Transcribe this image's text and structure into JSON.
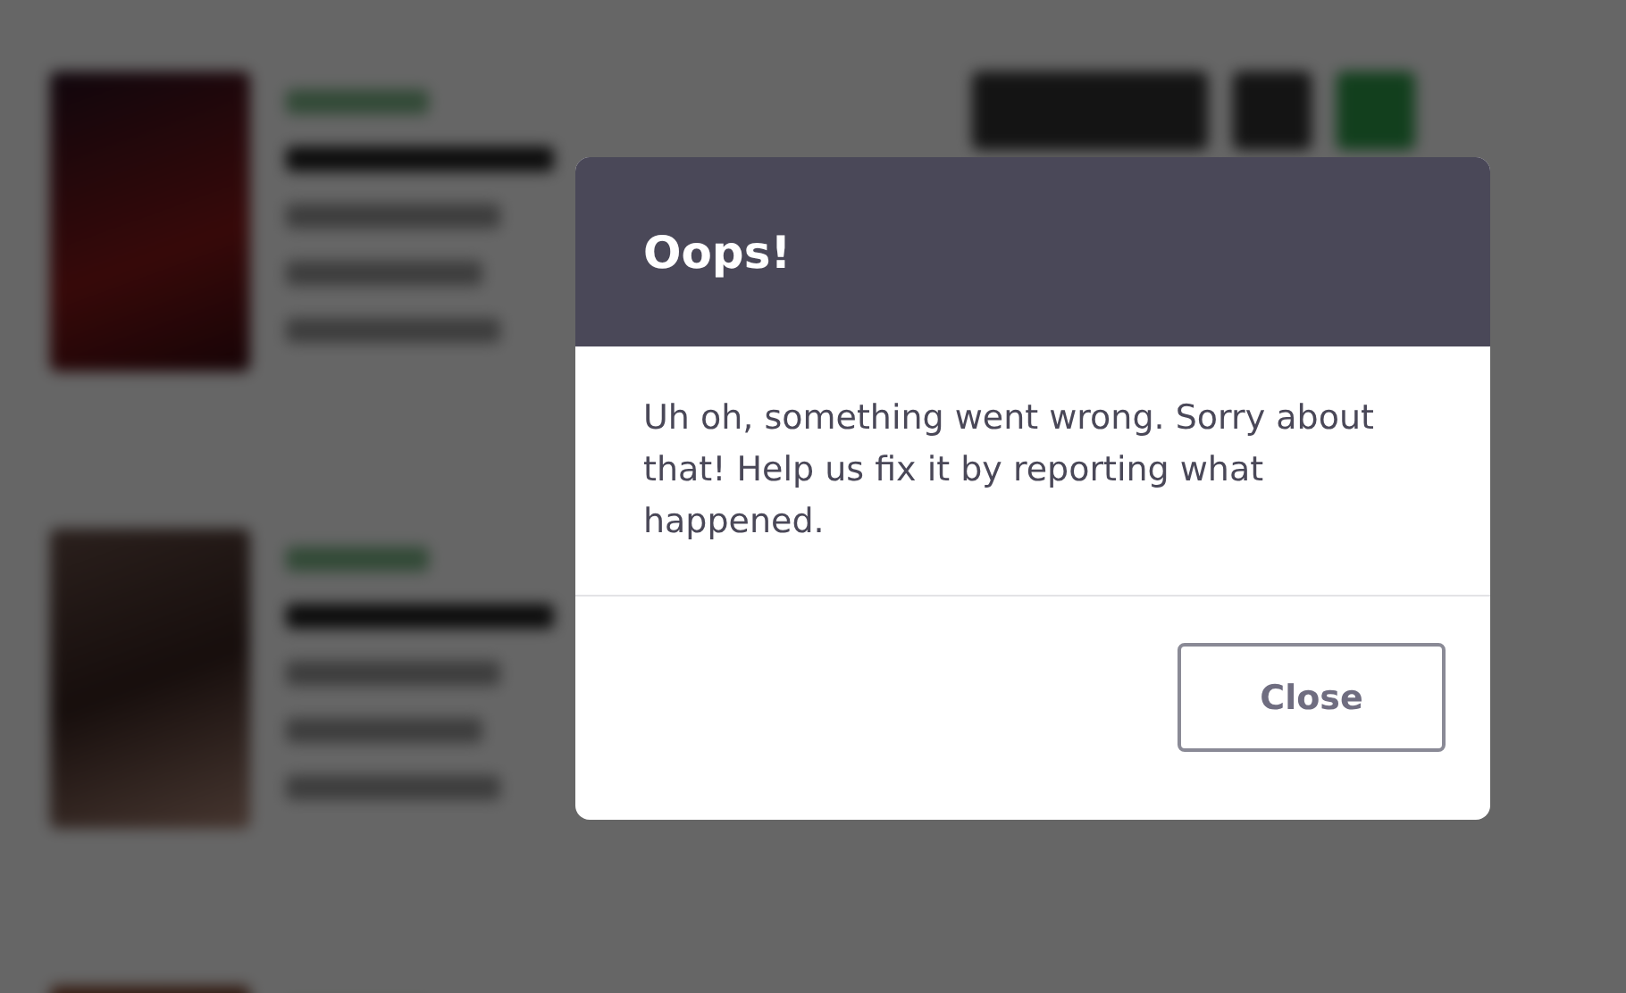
{
  "dialog": {
    "title": "Oops!",
    "message": "Uh oh, something went wrong. Sorry about that! Help us fix it by reporting what happened.",
    "buttons": [
      {
        "label": "Close"
      }
    ]
  }
}
